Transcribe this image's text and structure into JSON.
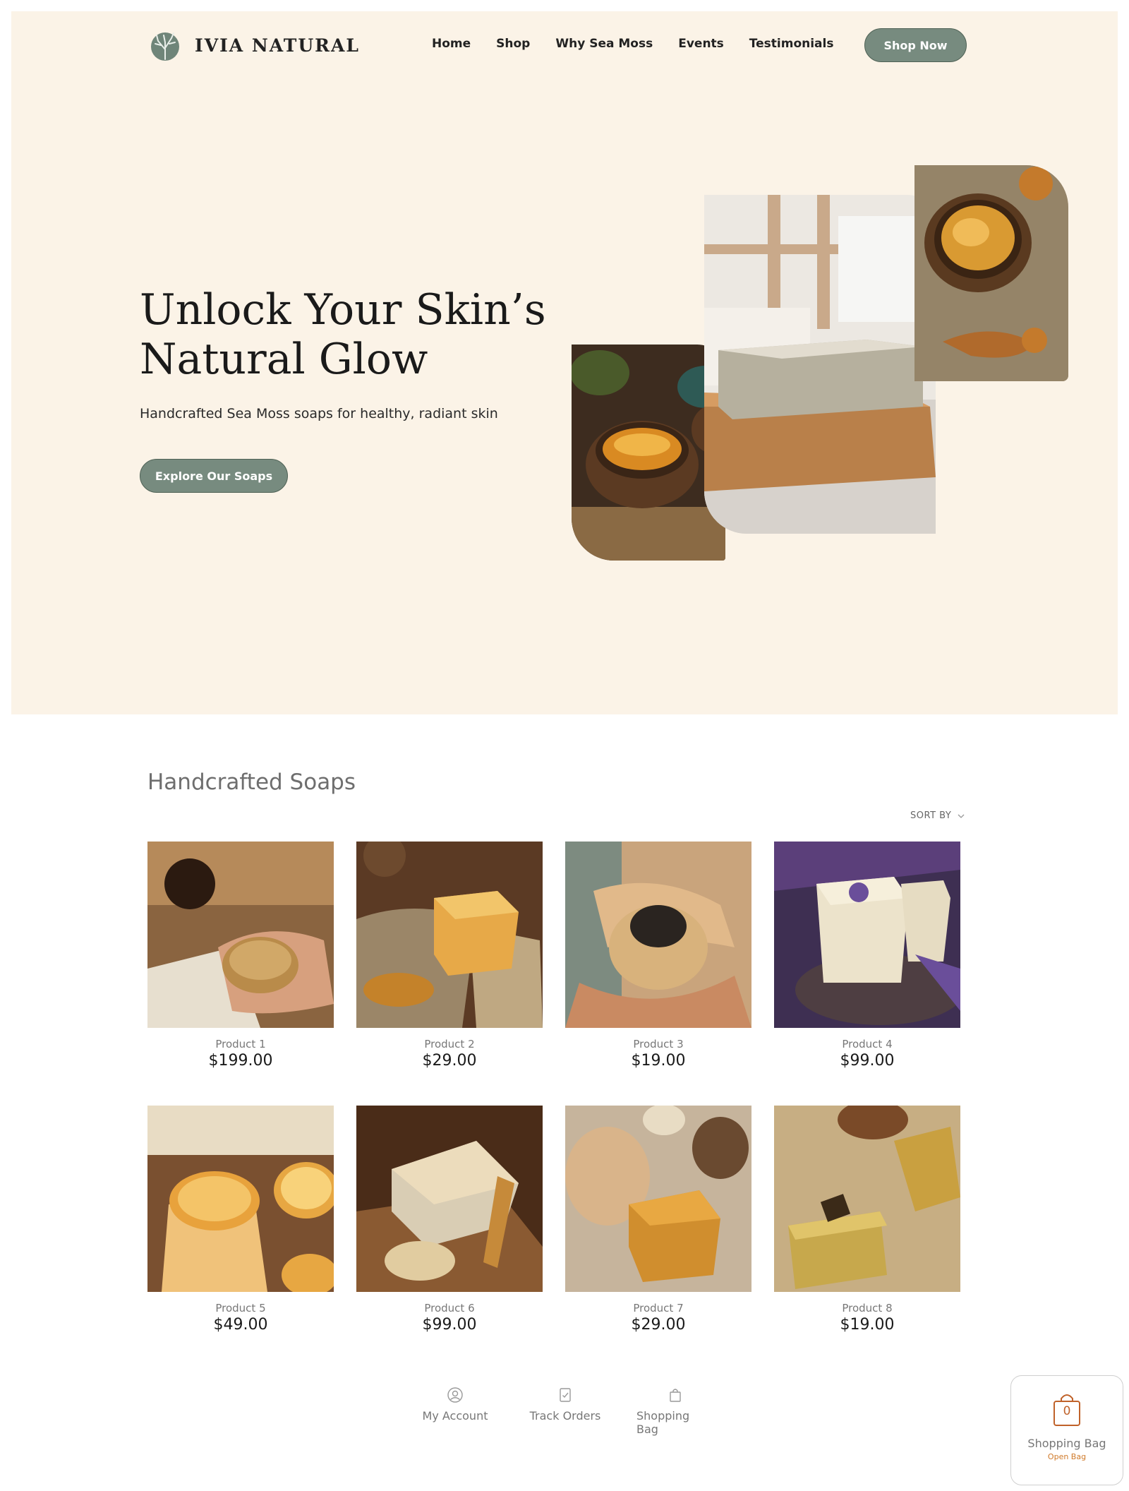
{
  "brand": {
    "name": "IVIA NATURAL"
  },
  "nav": {
    "items": [
      "Home",
      "Shop",
      "Why Sea Moss",
      "Events",
      "Testimonials"
    ],
    "cta": "Shop Now"
  },
  "hero": {
    "headline_line1": "Unlock Your Skin’s",
    "headline_line2": "Natural Glow",
    "subtitle": "Handcrafted Sea Moss soaps for healthy, radiant skin",
    "button": "Explore Our Soaps"
  },
  "catalog": {
    "title": "Handcrafted Soaps",
    "sort_label": "SORT BY",
    "products": [
      {
        "name": "Product 1",
        "price": "$199.00"
      },
      {
        "name": "Product 2",
        "price": "$29.00"
      },
      {
        "name": "Product 3",
        "price": "$19.00"
      },
      {
        "name": "Product 4",
        "price": "$99.00"
      },
      {
        "name": "Product 5",
        "price": "$49.00"
      },
      {
        "name": "Product 6",
        "price": "$99.00"
      },
      {
        "name": "Product 7",
        "price": "$29.00"
      },
      {
        "name": "Product 8",
        "price": "$19.00"
      }
    ]
  },
  "footer": {
    "my_account": "My Account",
    "track_orders": "Track Orders",
    "shopping_bag": "Shopping Bag"
  },
  "bag_widget": {
    "count": "0",
    "label": "Shopping Bag",
    "action": "Open Bag"
  },
  "colors": {
    "hero_bg": "#fbf3e7",
    "button": "#778b7f",
    "accent": "#c0622a"
  },
  "icons": [
    "coral-logo-icon",
    "user-icon",
    "checklist-icon",
    "bag-icon",
    "chevron-down-icon"
  ]
}
